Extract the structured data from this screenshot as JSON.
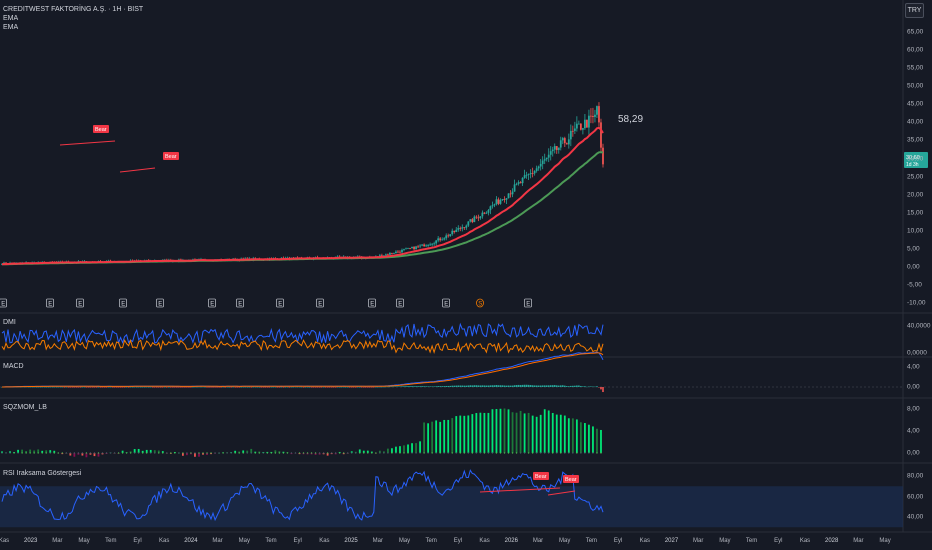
{
  "header": {
    "title": "CREDITWEST FAKTORİNG A.Ş. · 1H · BIST",
    "indicator_1": "EMA",
    "indicator_2": "EMA",
    "currency": "TRY"
  },
  "price_pane": {
    "annotation": "58,29",
    "last_price_badge": {
      "line1": "30,60",
      "line2": "1d 3h",
      "color": "#26a69a"
    },
    "y_axis_labels": [
      "65,00",
      "60,00",
      "55,00",
      "50,00",
      "45,00",
      "40,00",
      "35,00",
      "30,00",
      "25,00",
      "20,00",
      "15,00",
      "10,00",
      "5,00",
      "0,00",
      "-5,00",
      "-10,00"
    ],
    "event_markers": [
      "E",
      "E",
      "E",
      "E",
      "E",
      "E",
      "E",
      "E",
      "E",
      "E",
      "E",
      "E",
      "S",
      "E"
    ],
    "colors": {
      "up": "#26a69a",
      "down": "#ef5350",
      "ema_fast": "#f23645",
      "ema_slow": "#4c9a56"
    }
  },
  "panes": {
    "dmi": {
      "title": "DMI",
      "y_axis_labels": [
        "40,0000",
        "0,0000"
      ]
    },
    "macd": {
      "title": "MACD",
      "y_axis_labels": [
        "4,00",
        "0,00"
      ]
    },
    "sqzmom": {
      "title": "SQZMOM_LB",
      "y_axis_labels": [
        "8,00",
        "4,00",
        "0,00"
      ]
    },
    "rsi": {
      "title": "RSI Iraksama Göstergesi",
      "y_axis_labels": [
        "80,00",
        "60,00",
        "40,00"
      ],
      "bear_label": "Bear",
      "colors": {
        "line": "#2962ff",
        "band": "#1c3158",
        "bear": "#f23645"
      }
    }
  },
  "x_axis": {
    "labels": [
      "Kas",
      "2023",
      "Mar",
      "May",
      "Tem",
      "Eyl",
      "Kas",
      "2024",
      "Mar",
      "May",
      "Tem",
      "Eyl",
      "Kas",
      "2025",
      "Mar",
      "May",
      "Tem",
      "Eyl",
      "Kas",
      "2026",
      "Mar",
      "May",
      "Tem",
      "Eyl",
      "Kas",
      "2027",
      "Mar",
      "May",
      "Tem",
      "Eyl",
      "Kas",
      "2028",
      "Mar",
      "May"
    ]
  }
}
